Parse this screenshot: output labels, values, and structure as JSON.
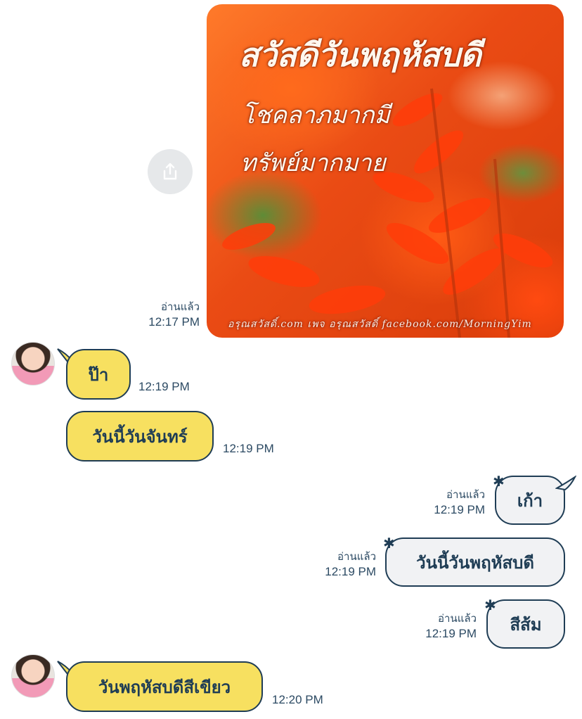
{
  "shared_image": {
    "title": "สวัสดีวันพฤหัสบดี",
    "line2": "โชคลาภมากมี",
    "line3": "ทรัพย์มากมาย",
    "footer": "อรุณสวัสดิ์.com  เพจ อรุณสวัสดิ์ facebook.com/MorningYim",
    "read_status": "อ่านแล้ว",
    "time": "12:17 PM"
  },
  "messages": [
    {
      "sender": "them",
      "text": "ป๊า",
      "time": "12:19 PM"
    },
    {
      "sender": "them",
      "text": "วันนี้วันจันทร์",
      "time": "12:19 PM"
    },
    {
      "sender": "me",
      "text": "เก้า",
      "read_status": "อ่านแล้ว",
      "time": "12:19 PM"
    },
    {
      "sender": "me",
      "text": "วันนี้วันพฤหัสบดี",
      "read_status": "อ่านแล้ว",
      "time": "12:19 PM"
    },
    {
      "sender": "me",
      "text": "สีส้ม",
      "read_status": "อ่านแล้ว",
      "time": "12:19 PM"
    },
    {
      "sender": "them",
      "text": "วันพฤหัสบดีสีเขียว",
      "time": "12:20 PM"
    }
  ],
  "colors": {
    "incoming_bubble": "#f7e060",
    "outgoing_bubble": "#f1f2f4",
    "outline": "#1f3d55"
  }
}
